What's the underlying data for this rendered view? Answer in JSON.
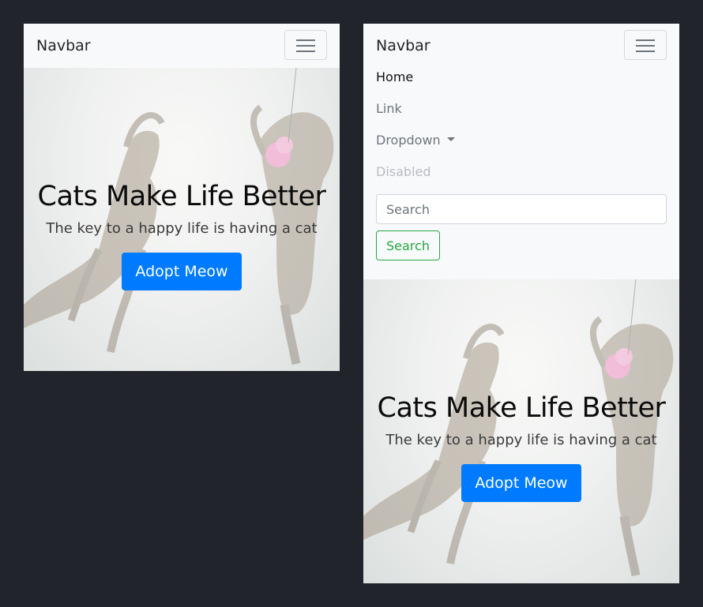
{
  "navbar": {
    "brand": "Navbar",
    "toggler_icon": "hamburger-icon"
  },
  "menu": {
    "items": [
      {
        "label": "Home",
        "state": "active"
      },
      {
        "label": "Link",
        "state": "default"
      },
      {
        "label": "Dropdown",
        "state": "dropdown"
      },
      {
        "label": "Disabled",
        "state": "disabled"
      }
    ],
    "search_placeholder": "Search",
    "search_button": "Search"
  },
  "hero": {
    "title": "Cats Make Life Better",
    "subtitle": "The key to a happy life is having a cat",
    "cta": "Adopt Meow",
    "background_image": "playing-cats-photo"
  },
  "colors": {
    "page_bg": "#21252b",
    "navbar_bg": "#f8f9fa",
    "primary": "#007bff",
    "success": "#28a745"
  }
}
